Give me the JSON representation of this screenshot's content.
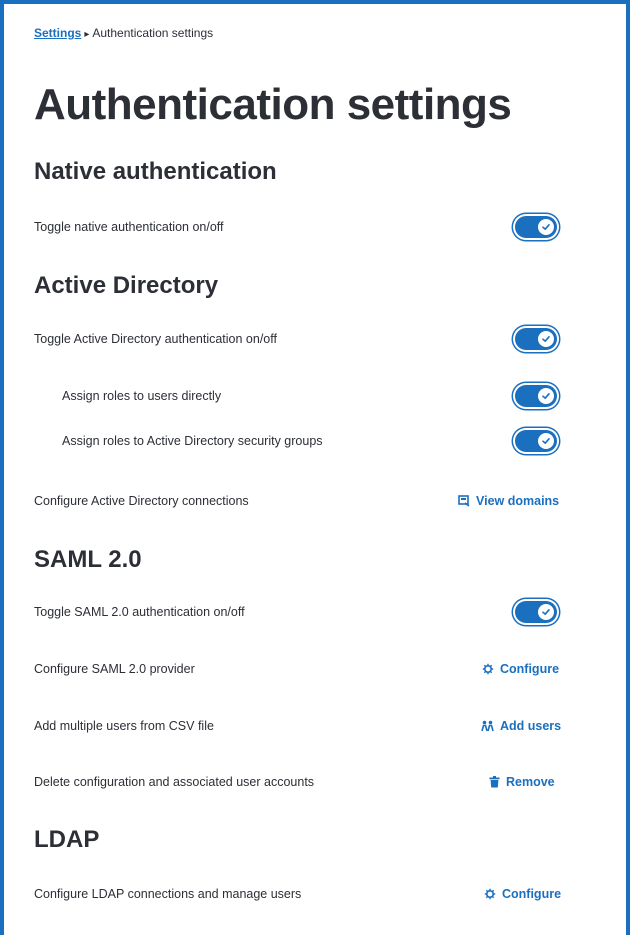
{
  "breadcrumb": {
    "parent": "Settings",
    "current": "Authentication settings"
  },
  "page_title": "Authentication settings",
  "sections": {
    "native": {
      "title": "Native authentication",
      "toggle_label": "Toggle native authentication on/off",
      "toggle_on": true
    },
    "active_directory": {
      "title": "Active Directory",
      "toggle_label": "Toggle Active Directory authentication on/off",
      "assign_users_label": "Assign roles to users directly",
      "assign_groups_label": "Assign roles to Active Directory security groups",
      "connections_label": "Configure Active Directory connections",
      "view_domains": "View domains"
    },
    "saml": {
      "title": "SAML 2.0",
      "toggle_label": "Toggle SAML 2.0 authentication on/off",
      "provider_label": "Configure SAML 2.0 provider",
      "configure": "Configure",
      "csv_label": "Add multiple users from CSV file",
      "add_users": "Add users",
      "delete_label": "Delete configuration and associated user accounts",
      "remove": "Remove"
    },
    "ldap": {
      "title": "LDAP",
      "connections_label": "Configure LDAP connections and manage users",
      "configure": "Configure"
    }
  },
  "colors": {
    "accent": "#1b6fbf",
    "text": "#2c2f36"
  }
}
